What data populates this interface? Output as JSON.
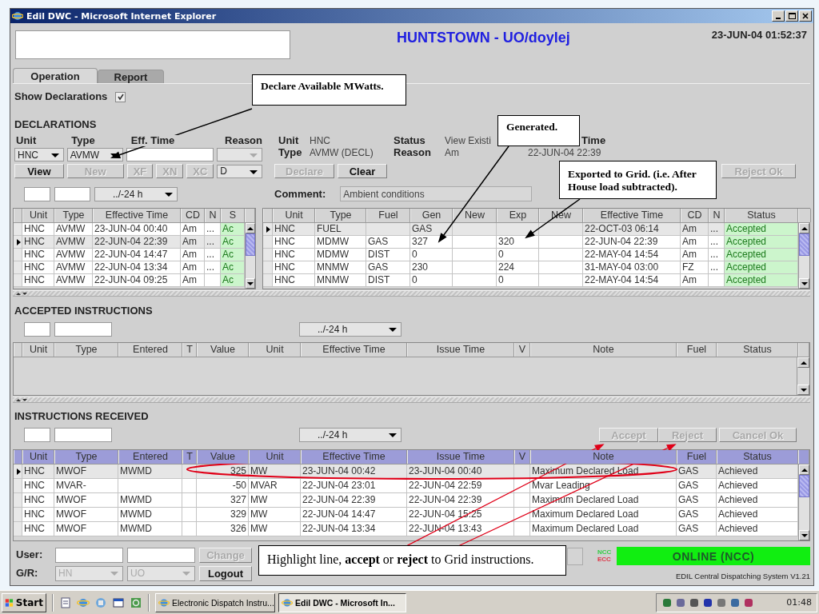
{
  "window": {
    "title": "Edil DWC - Microsoft Internet Explorer"
  },
  "header": {
    "title": "HUNTSTOWN - UO/doylej",
    "datetime": "23-JUN-04 01:52:37"
  },
  "tabs": [
    {
      "label": "Operation",
      "selected": true
    },
    {
      "label": "Report",
      "selected": false
    }
  ],
  "show_declarations": {
    "label": "Show Declarations",
    "checked": true
  },
  "declarations": {
    "heading": "DECLARATIONS",
    "unit": {
      "label": "Unit",
      "value": "HNC"
    },
    "type": {
      "label": "Type",
      "value": "AVMW"
    },
    "eff_time": {
      "label": "Eff. Time"
    },
    "reason": {
      "label": "Reason",
      "disabled": true
    },
    "buttons": [
      {
        "label": "View",
        "disabled": false
      },
      {
        "label": "New",
        "disabled": true
      },
      {
        "label": "XF",
        "disabled": true
      },
      {
        "label": "XN",
        "disabled": true
      },
      {
        "label": "XC",
        "disabled": true
      }
    ],
    "reason_code": {
      "value": "D"
    },
    "detail": [
      {
        "label": "Unit",
        "value": "HNC"
      },
      {
        "label": "Type",
        "value": "AVMW (DECL)"
      },
      {
        "label": "Status",
        "value": "View Existi"
      },
      {
        "label": "Reason",
        "value": "Am"
      },
      {
        "label": "Time",
        "value": "22-JUN-04 22:39"
      }
    ],
    "actions": [
      {
        "label": "Declare",
        "disabled": true
      },
      {
        "label": "Clear",
        "disabled": false
      }
    ],
    "reject_ok": {
      "label": "Reject Ok",
      "disabled": true
    },
    "range": "../-24 h",
    "comment": {
      "label": "Comment:",
      "value": "Ambient conditions"
    },
    "list": {
      "columns": [
        "Unit",
        "Type",
        "Effective Time",
        "CD",
        "N",
        "S"
      ],
      "rows": [
        {
          "unit": "HNC",
          "type": "AVMW",
          "effective_time": "23-JUN-04 00:40",
          "cd": "Am",
          "n": "...",
          "s": "Ac",
          "selected": false
        },
        {
          "unit": "HNC",
          "type": "AVMW",
          "effective_time": "22-JUN-04 22:39",
          "cd": "Am",
          "n": "...",
          "s": "Ac",
          "selected": true
        },
        {
          "unit": "HNC",
          "type": "AVMW",
          "effective_time": "22-JUN-04 14:47",
          "cd": "Am",
          "n": "...",
          "s": "Ac",
          "selected": false
        },
        {
          "unit": "HNC",
          "type": "AVMW",
          "effective_time": "22-JUN-04 13:34",
          "cd": "Am",
          "n": "...",
          "s": "Ac",
          "selected": false
        },
        {
          "unit": "HNC",
          "type": "AVMW",
          "effective_time": "22-JUN-04 09:25",
          "cd": "Am",
          "s": "Ac",
          "selected": false
        }
      ]
    },
    "details": {
      "columns": [
        "Unit",
        "Type",
        "Fuel",
        "Gen",
        "New",
        "Exp",
        "New",
        "Effective Time",
        "CD",
        "N",
        "Status"
      ],
      "rows": [
        {
          "unit": "HNC",
          "type": "FUEL",
          "gen": "GAS",
          "effective_time": "22-OCT-03 06:14",
          "cd": "Am",
          "n": "...",
          "status": "Accepted",
          "selected": true
        },
        {
          "unit": "HNC",
          "type": "MDMW",
          "fuel": "GAS",
          "gen": "327",
          "exp": "320",
          "effective_time": "22-JUN-04 22:39",
          "cd": "Am",
          "n": "...",
          "status": "Accepted",
          "selected": false
        },
        {
          "unit": "HNC",
          "type": "MDMW",
          "fuel": "DIST",
          "gen": "0",
          "exp": "0",
          "effective_time": "22-MAY-04 14:54",
          "cd": "Am",
          "n": "...",
          "status": "Accepted",
          "selected": false
        },
        {
          "unit": "HNC",
          "type": "MNMW",
          "fuel": "GAS",
          "gen": "230",
          "exp": "224",
          "effective_time": "31-MAY-04 03:00",
          "cd": "FZ",
          "n": "...",
          "status": "Accepted",
          "selected": false
        },
        {
          "unit": "HNC",
          "type": "MNMW",
          "fuel": "DIST",
          "gen": "0",
          "exp": "0",
          "effective_time": "22-MAY-04 14:54",
          "cd": "Am",
          "status": "Accepted",
          "selected": false
        }
      ]
    }
  },
  "accepted_instructions": {
    "heading": "ACCEPTED INSTRUCTIONS",
    "range": "../-24 h",
    "columns": [
      "Unit",
      "Type",
      "Entered",
      "T",
      "Value",
      "Unit",
      "Effective Time",
      "Issue Time",
      "V",
      "Note",
      "Fuel",
      "Status"
    ]
  },
  "instructions_received": {
    "heading": "INSTRUCTIONS RECEIVED",
    "range": "../-24 h",
    "buttons": [
      {
        "label": "Accept",
        "disabled": true
      },
      {
        "label": "Reject",
        "disabled": true
      },
      {
        "label": "Cancel Ok",
        "disabled": true
      }
    ],
    "columns": [
      "Unit",
      "Type",
      "Entered",
      "T",
      "Value",
      "Unit",
      "Effective Time",
      "Issue Time",
      "V",
      "Note",
      "Fuel",
      "Status"
    ],
    "rows": [
      {
        "unit": "HNC",
        "type": "MWOF",
        "entered": "MWMD",
        "value": "325",
        "value_unit": "MW",
        "effective_time": "23-JUN-04 00:42",
        "issue_time": "23-JUN-04 00:40",
        "note": "Maximum Declared Load",
        "fuel": "GAS",
        "status": "Achieved",
        "selected": true
      },
      {
        "unit": "HNC",
        "type": "MVAR-",
        "value": "-50",
        "value_unit": "MVAR",
        "effective_time": "22-JUN-04 23:01",
        "issue_time": "22-JUN-04 22:59",
        "note": "Mvar Leading",
        "fuel": "GAS",
        "status": "Achieved",
        "selected": false
      },
      {
        "unit": "HNC",
        "type": "MWOF",
        "entered": "MWMD",
        "value": "327",
        "value_unit": "MW",
        "effective_time": "22-JUN-04 22:39",
        "issue_time": "22-JUN-04 22:39",
        "note": "Maximum Declared Load",
        "fuel": "GAS",
        "status": "Achieved",
        "selected": false
      },
      {
        "unit": "HNC",
        "type": "MWOF",
        "entered": "MWMD",
        "value": "329",
        "value_unit": "MW",
        "effective_time": "22-JUN-04 14:47",
        "issue_time": "22-JUN-04 15:25",
        "note": "Maximum Declared Load",
        "fuel": "GAS",
        "status": "Achieved",
        "selected": false
      },
      {
        "unit": "HNC",
        "type": "MWOF",
        "entered": "MWMD",
        "value": "326",
        "value_unit": "MW",
        "effective_time": "22-JUN-04 13:34",
        "issue_time": "22-JUN-04 13:43",
        "note": "Maximum Declared Load",
        "fuel": "GAS",
        "status": "Achieved",
        "selected": false
      }
    ]
  },
  "footer": {
    "user_label": "User:",
    "group_label": "G/R:",
    "group": [
      {
        "value": "HN",
        "disabled": true
      },
      {
        "value": "UO",
        "disabled": true
      }
    ],
    "buttons": [
      {
        "label": "Change",
        "disabled": true
      },
      {
        "label": "Logout",
        "disabled": false
      }
    ],
    "indicators": [
      {
        "label": "NCC",
        "color": "#33cc44"
      },
      {
        "label": "ECC",
        "color": "#dd3344"
      }
    ],
    "status": "ONLINE (NCC)",
    "version": "EDIL Central Dispatching System V1.21"
  },
  "annotations": [
    {
      "text": "Declare Available MWatts."
    },
    {
      "text": "Generated."
    },
    {
      "text": "Exported to Grid. (i.e. After House load subtracted)."
    },
    {
      "text": "Highlight line, **accept** or **reject** to Grid instructions."
    }
  ],
  "taskbar": {
    "start": "Start",
    "tasks": [
      {
        "label": "Electronic Dispatch Instru...",
        "selected": false
      },
      {
        "label": "Edil DWC - Microsoft In...",
        "selected": true
      }
    ],
    "clock": "01:48"
  }
}
